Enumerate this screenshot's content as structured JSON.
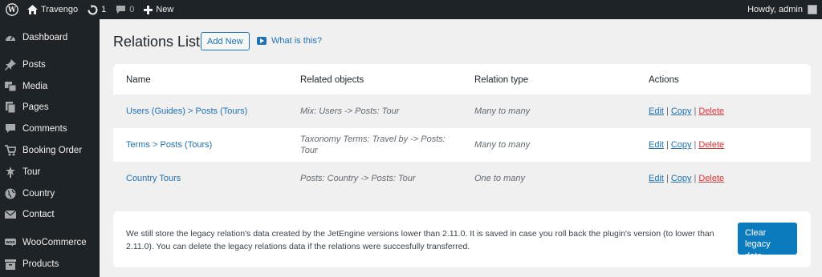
{
  "adminbar": {
    "site_name": "Travengo",
    "updates_count": "1",
    "comments_count": "0",
    "new_label": "New",
    "howdy": "Howdy, admin"
  },
  "sidebar": {
    "items": [
      {
        "label": "Dashboard",
        "icon": "dashboard-icon"
      },
      {
        "label": "Posts",
        "icon": "pin-icon"
      },
      {
        "label": "Media",
        "icon": "media-icon"
      },
      {
        "label": "Pages",
        "icon": "pages-icon"
      },
      {
        "label": "Comments",
        "icon": "comment-icon"
      },
      {
        "label": "Booking Order",
        "icon": "cart-icon"
      },
      {
        "label": "Tour",
        "icon": "star-person-icon"
      },
      {
        "label": "Country",
        "icon": "globe-icon"
      },
      {
        "label": "Contact",
        "icon": "envelope-icon"
      },
      {
        "label": "WooCommerce",
        "icon": "woo-icon"
      },
      {
        "label": "Products",
        "icon": "archive-icon"
      }
    ]
  },
  "main": {
    "title": "Relations List",
    "add_new": "Add New",
    "what_is_this": "What is this?",
    "table": {
      "headers": [
        "Name",
        "Related objects",
        "Relation type",
        "Actions"
      ],
      "rows": [
        {
          "name": "Users (Guides) > Posts (Tours)",
          "objects": "Mix: Users -> Posts: Tour",
          "type": "Many to many"
        },
        {
          "name": "Terms > Posts (Tours)",
          "objects": "Taxonomy Terms: Travel by -> Posts: Tour",
          "type": "Many to many"
        },
        {
          "name": "Country Tours",
          "objects": "Posts: Country -> Posts: Tour",
          "type": "One to many"
        }
      ],
      "actions": {
        "edit": "Edit",
        "copy": "Copy",
        "delete": "Delete",
        "separator": "|"
      }
    },
    "notice": {
      "text": "We still store the legacy relation's data created by the JetEngine versions lower than 2.11.0. It is saved in case you roll back the plugin's version (to lower than 2.11.0). You can delete the legacy relations data if the relations were succesfully transferred.",
      "button": "Clear legacy data"
    }
  },
  "colors": {
    "adminbar_bg": "#1d2327",
    "link": "#2271b1",
    "delete": "#d63638",
    "primary_button": "#0c7bbd"
  }
}
